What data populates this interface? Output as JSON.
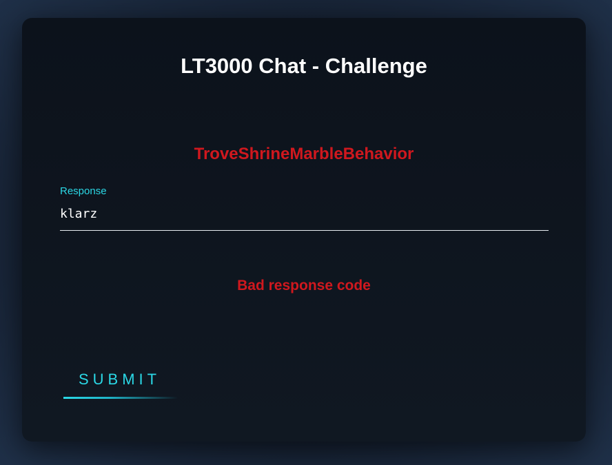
{
  "app": {
    "title": "LT3000 Chat - Challenge"
  },
  "challenge": {
    "phrase": "TroveShrineMarbleBehavior"
  },
  "response_field": {
    "label": "Response",
    "value": "klarz"
  },
  "status": {
    "error_message": "Bad response code"
  },
  "actions": {
    "submit_label": "SUBMIT"
  },
  "colors": {
    "accent": "#2bd8e6",
    "error": "#d0181e",
    "card_background": "#0e1520",
    "title": "#ffffff"
  }
}
